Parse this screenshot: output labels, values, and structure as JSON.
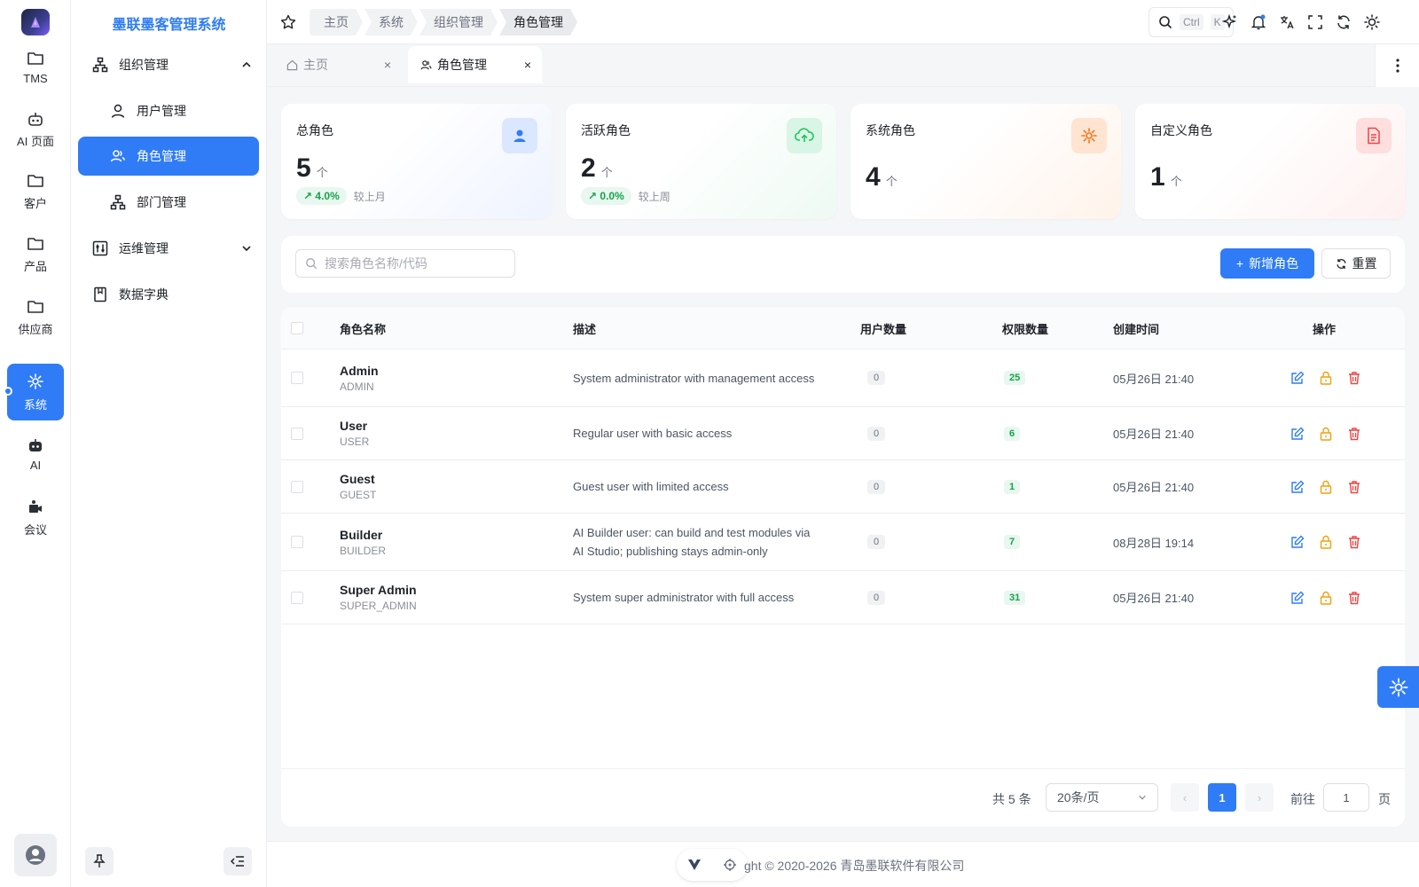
{
  "app": {
    "title": "墨联墨客管理系统"
  },
  "rail": {
    "items": [
      {
        "label": "TMS",
        "icon": "folder-icon"
      },
      {
        "label": "AI 页面",
        "icon": "robot-icon"
      },
      {
        "label": "客户",
        "icon": "folder-icon"
      },
      {
        "label": "产品",
        "icon": "folder-icon"
      },
      {
        "label": "供应商",
        "icon": "folder-icon"
      },
      {
        "label": "系统",
        "icon": "gear-icon",
        "active": true
      },
      {
        "label": "AI",
        "icon": "robot-icon"
      },
      {
        "label": "会议",
        "icon": "meeting-icon"
      }
    ]
  },
  "menu": {
    "org": "组织管理",
    "users": "用户管理",
    "roles": "角色管理",
    "depts": "部门管理",
    "ops": "运维管理",
    "dict": "数据字典"
  },
  "breadcrumb": [
    "主页",
    "系统",
    "组织管理",
    "角色管理"
  ],
  "search": {
    "kbd1": "Ctrl",
    "kbd2": "K"
  },
  "tabs": [
    {
      "label": "主页",
      "icon": "home-icon"
    },
    {
      "label": "角色管理",
      "icon": "roles-icon",
      "active": true
    }
  ],
  "cards": [
    {
      "label": "总角色",
      "value": "5",
      "unit": "个",
      "trend": "4.0%",
      "trend_note": "较上月",
      "color": "#2f7cf6"
    },
    {
      "label": "活跃角色",
      "value": "2",
      "unit": "个",
      "trend": "0.0%",
      "trend_note": "较上周",
      "color": "#22c55e"
    },
    {
      "label": "系统角色",
      "value": "4",
      "unit": "个",
      "color": "#f97316"
    },
    {
      "label": "自定义角色",
      "value": "1",
      "unit": "个",
      "color": "#ef4444"
    }
  ],
  "toolbar": {
    "search_placeholder": "搜索角色名称/代码",
    "add_label": "新增角色",
    "reset_label": "重置"
  },
  "table": {
    "headers": {
      "name": "角色名称",
      "desc": "描述",
      "users": "用户数量",
      "perms": "权限数量",
      "created": "创建时间",
      "ops": "操作"
    },
    "rows": [
      {
        "name": "Admin",
        "code": "ADMIN",
        "desc": "System administrator with management access",
        "users": "0",
        "perms": "25",
        "created": "05月26日 21:40"
      },
      {
        "name": "User",
        "code": "USER",
        "desc": "Regular user with basic access",
        "users": "0",
        "perms": "6",
        "created": "05月26日 21:40"
      },
      {
        "name": "Guest",
        "code": "GUEST",
        "desc": "Guest user with limited access",
        "users": "0",
        "perms": "1",
        "created": "05月26日 21:40"
      },
      {
        "name": "Builder",
        "code": "BUILDER",
        "desc": "AI Builder user: can build and test modules via AI Studio; publishing stays admin-only",
        "users": "0",
        "perms": "7",
        "created": "08月28日 19:14"
      },
      {
        "name": "Super Admin",
        "code": "SUPER_ADMIN",
        "desc": "System super administrator with full access",
        "users": "0",
        "perms": "31",
        "created": "05月26日 21:40"
      }
    ]
  },
  "pagination": {
    "total": "共 5 条",
    "page_size": "20条/页",
    "current": "1",
    "goto_label": "前往",
    "goto_value": "1",
    "page_suffix": "页"
  },
  "footer": {
    "text": "ght © 2020-2026  青岛墨联软件有限公司"
  },
  "colors": {
    "primary": "#2f7cf6",
    "success": "#16a34a",
    "warning": "#f59e0b",
    "danger": "#ef4444"
  }
}
